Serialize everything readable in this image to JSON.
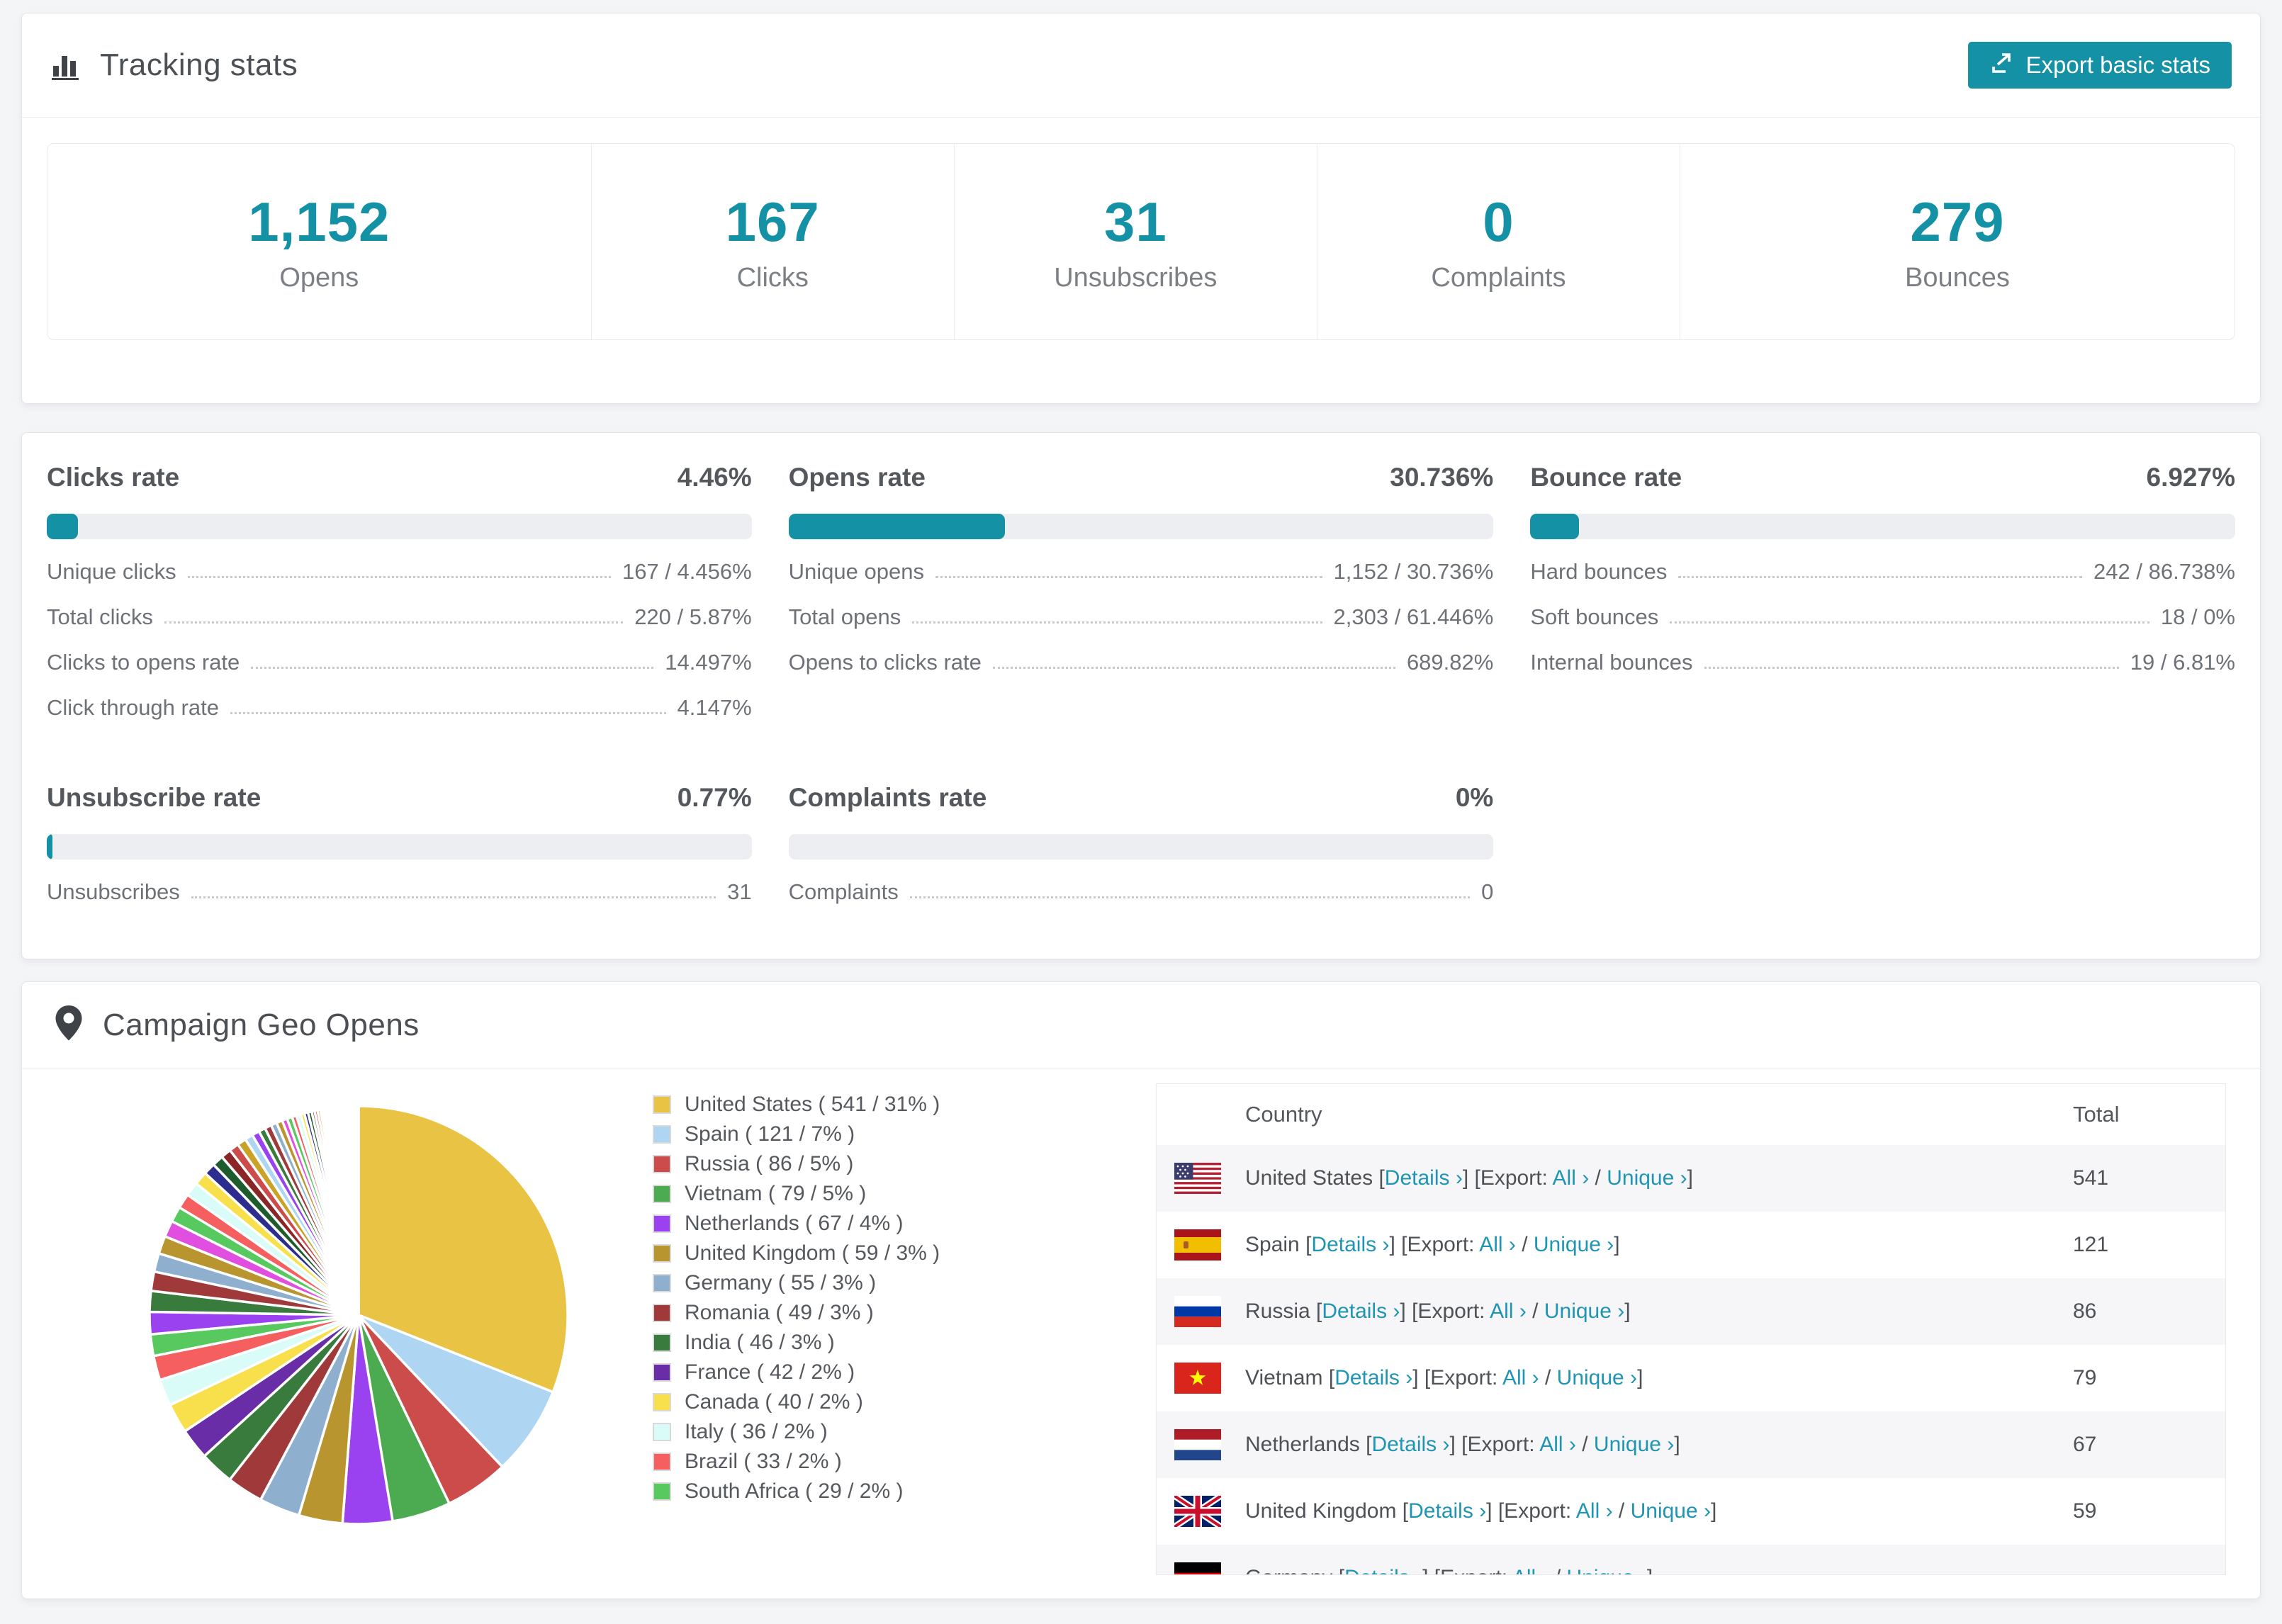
{
  "accent": "#1591a5",
  "link_color": "#2095b3",
  "header": {
    "title": "Tracking stats",
    "export_label": "Export basic stats"
  },
  "stats": [
    {
      "value": "1,152",
      "label": "Opens"
    },
    {
      "value": "167",
      "label": "Clicks"
    },
    {
      "value": "31",
      "label": "Unsubscribes"
    },
    {
      "value": "0",
      "label": "Complaints"
    },
    {
      "value": "279",
      "label": "Bounces"
    }
  ],
  "rates": [
    {
      "title": "Clicks rate",
      "value": "4.46%",
      "percent": 4.46,
      "rows": [
        {
          "label": "Unique clicks",
          "value": "167 / 4.456%"
        },
        {
          "label": "Total clicks",
          "value": "220 / 5.87%"
        },
        {
          "label": "Clicks to opens rate",
          "value": "14.497%"
        },
        {
          "label": "Click through rate",
          "value": "4.147%"
        }
      ]
    },
    {
      "title": "Opens rate",
      "value": "30.736%",
      "percent": 30.736,
      "rows": [
        {
          "label": "Unique opens",
          "value": "1,152 / 30.736%"
        },
        {
          "label": "Total opens",
          "value": "2,303 / 61.446%"
        },
        {
          "label": "Opens to clicks rate",
          "value": "689.82%"
        }
      ]
    },
    {
      "title": "Bounce rate",
      "value": "6.927%",
      "percent": 6.927,
      "rows": [
        {
          "label": "Hard bounces",
          "value": "242 / 86.738%"
        },
        {
          "label": "Soft bounces",
          "value": "18 / 0%"
        },
        {
          "label": "Internal bounces",
          "value": "19 / 6.81%"
        }
      ]
    },
    {
      "title": "Unsubscribe rate",
      "value": "0.77%",
      "percent": 0.77,
      "rows": [
        {
          "label": "Unsubscribes",
          "value": "31"
        }
      ]
    },
    {
      "title": "Complaints rate",
      "value": "0%",
      "percent": 0,
      "rows": [
        {
          "label": "Complaints",
          "value": "0"
        }
      ]
    }
  ],
  "chart_data": {
    "type": "pie",
    "title": "Campaign Geo Opens",
    "legend_position": "right",
    "start_angle_deg": -90,
    "series": [
      {
        "name": "United States",
        "value": 541,
        "pct": 31,
        "color": "#e9c344"
      },
      {
        "name": "Spain",
        "value": 121,
        "pct": 7,
        "color": "#aed6f2"
      },
      {
        "name": "Russia",
        "value": 86,
        "pct": 5,
        "color": "#cc4b4b"
      },
      {
        "name": "Vietnam",
        "value": 79,
        "pct": 5,
        "color": "#4caa51"
      },
      {
        "name": "Netherlands",
        "value": 67,
        "pct": 4,
        "color": "#9a41f0"
      },
      {
        "name": "United Kingdom",
        "value": 59,
        "pct": 3,
        "color": "#b8952f"
      },
      {
        "name": "Germany",
        "value": 55,
        "pct": 3,
        "color": "#8fafce"
      },
      {
        "name": "Romania",
        "value": 49,
        "pct": 3,
        "color": "#a03a3a"
      },
      {
        "name": "India",
        "value": 46,
        "pct": 3,
        "color": "#397a3d"
      },
      {
        "name": "France",
        "value": 42,
        "pct": 2,
        "color": "#6a2da8"
      },
      {
        "name": "Canada",
        "value": 40,
        "pct": 2,
        "color": "#f7e04b"
      },
      {
        "name": "Italy",
        "value": 36,
        "pct": 2,
        "color": "#d9fcf8"
      },
      {
        "name": "Brazil",
        "value": 33,
        "pct": 2,
        "color": "#f55f5f"
      },
      {
        "name": "South Africa",
        "value": 29,
        "pct": 2,
        "color": "#57c95f"
      }
    ],
    "others_values": [
      30,
      28,
      26,
      25,
      24,
      22,
      21,
      20,
      19,
      18,
      16,
      15,
      14,
      13,
      12,
      11,
      10,
      9,
      9,
      8,
      8,
      7,
      7,
      6,
      6,
      5,
      5,
      5,
      4,
      4,
      4,
      3,
      3,
      3,
      3,
      2,
      2,
      2,
      2,
      2,
      2,
      2,
      2,
      2,
      2,
      2,
      2,
      1,
      1,
      1,
      1,
      1,
      1,
      1,
      1,
      1,
      1,
      1,
      1,
      1,
      1,
      1
    ],
    "others_colors": [
      "#9a41f0",
      "#397a3d",
      "#a03a3a",
      "#8fafce",
      "#b8952f",
      "#e04fe0",
      "#57c95f",
      "#f55f5f",
      "#d9fcf8",
      "#f7e04b",
      "#2d2d8f",
      "#1e5c2e",
      "#8b2626",
      "#cc4b4b",
      "#c9a227",
      "#aed6f2"
    ]
  },
  "geo": {
    "title": "Campaign Geo Opens",
    "table": {
      "col_country": "Country",
      "col_total": "Total",
      "bracket_open": "[",
      "bracket_close": "]",
      "details_label": "Details ›",
      "export_label": "[Export:",
      "all_label": "All ›",
      "slash": "/",
      "unique_label": "Unique ›",
      "rows": [
        {
          "country": "United States",
          "flag": "us",
          "total": "541"
        },
        {
          "country": "Spain",
          "flag": "es",
          "total": "121"
        },
        {
          "country": "Russia",
          "flag": "ru",
          "total": "86"
        },
        {
          "country": "Vietnam",
          "flag": "vn",
          "total": "79"
        },
        {
          "country": "Netherlands",
          "flag": "nl",
          "total": "67"
        },
        {
          "country": "United Kingdom",
          "flag": "gb",
          "total": "59"
        },
        {
          "country": "Germany",
          "flag": "de",
          "total": ""
        }
      ]
    }
  }
}
